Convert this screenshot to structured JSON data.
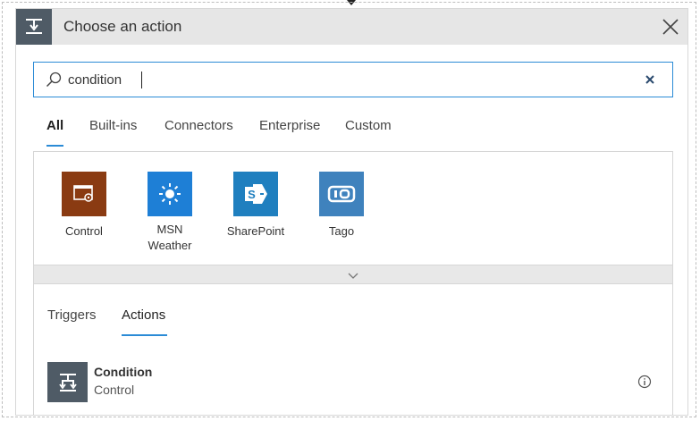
{
  "header": {
    "title": "Choose an action",
    "icon": "condition-icon",
    "close_icon": "close-icon",
    "background": "#e6e6e6",
    "icon_background": "#4f5b66"
  },
  "search": {
    "value": "condition",
    "placeholder": "",
    "icon": "search-icon",
    "clear_icon": "clear-icon",
    "border_color": "#2b8bd6"
  },
  "tabs": {
    "items": [
      {
        "label": "All",
        "active": true
      },
      {
        "label": "Built-ins",
        "active": false
      },
      {
        "label": "Connectors",
        "active": false
      },
      {
        "label": "Enterprise",
        "active": false
      },
      {
        "label": "Custom",
        "active": false
      }
    ],
    "accent": "#2b8bd6"
  },
  "connectors": [
    {
      "label": "Control",
      "icon": "control-icon",
      "color": "#8a3b12"
    },
    {
      "label": "MSN Weather",
      "icon": "sun-icon",
      "color": "#1e7fd6"
    },
    {
      "label": "SharePoint",
      "icon": "sharepoint-icon",
      "color": "#1f7fbf"
    },
    {
      "label": "Tago",
      "icon": "tago-icon",
      "color": "#3f82bd"
    }
  ],
  "expand": {
    "icon": "chevron-down-icon"
  },
  "subtabs": {
    "items": [
      {
        "label": "Triggers",
        "active": false
      },
      {
        "label": "Actions",
        "active": true
      }
    ]
  },
  "actions": [
    {
      "title": "Condition",
      "subtitle": "Control",
      "icon": "condition-icon",
      "info_icon": "info-icon"
    }
  ]
}
